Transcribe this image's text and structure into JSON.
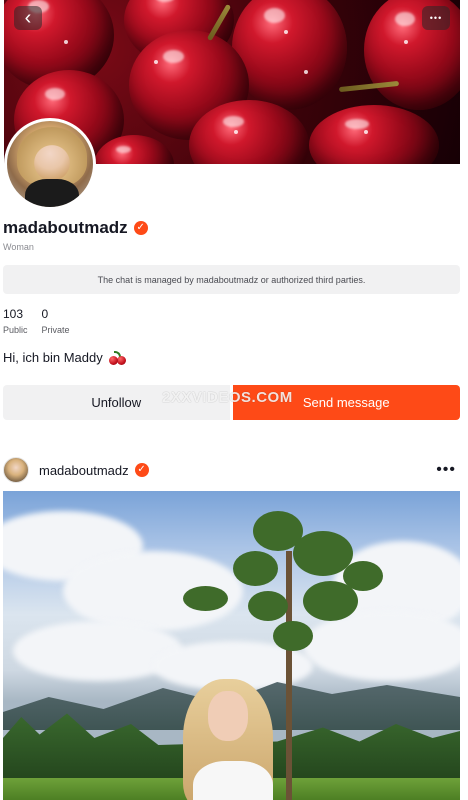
{
  "profile": {
    "username": "madaboutmadz",
    "gender": "Woman",
    "chat_notice": "The chat is managed by madaboutmadz or authorized third parties.",
    "stats": [
      {
        "value": "103",
        "label": "Public"
      },
      {
        "value": "0",
        "label": "Private"
      }
    ],
    "bio": "Hi, ich bin Maddy",
    "verified_icon": "verified-badge-icon"
  },
  "actions": {
    "unfollow_label": "Unfollow",
    "message_label": "Send message"
  },
  "watermark": "2XXVIDEOS.COM",
  "post": {
    "username": "madaboutmadz",
    "more_label": "•••"
  },
  "cover": {
    "back_label": "‹",
    "more_label": "•••"
  },
  "colors": {
    "accent": "#fe4a17",
    "text": "#161823",
    "muted_bg": "#f1f1f2"
  }
}
